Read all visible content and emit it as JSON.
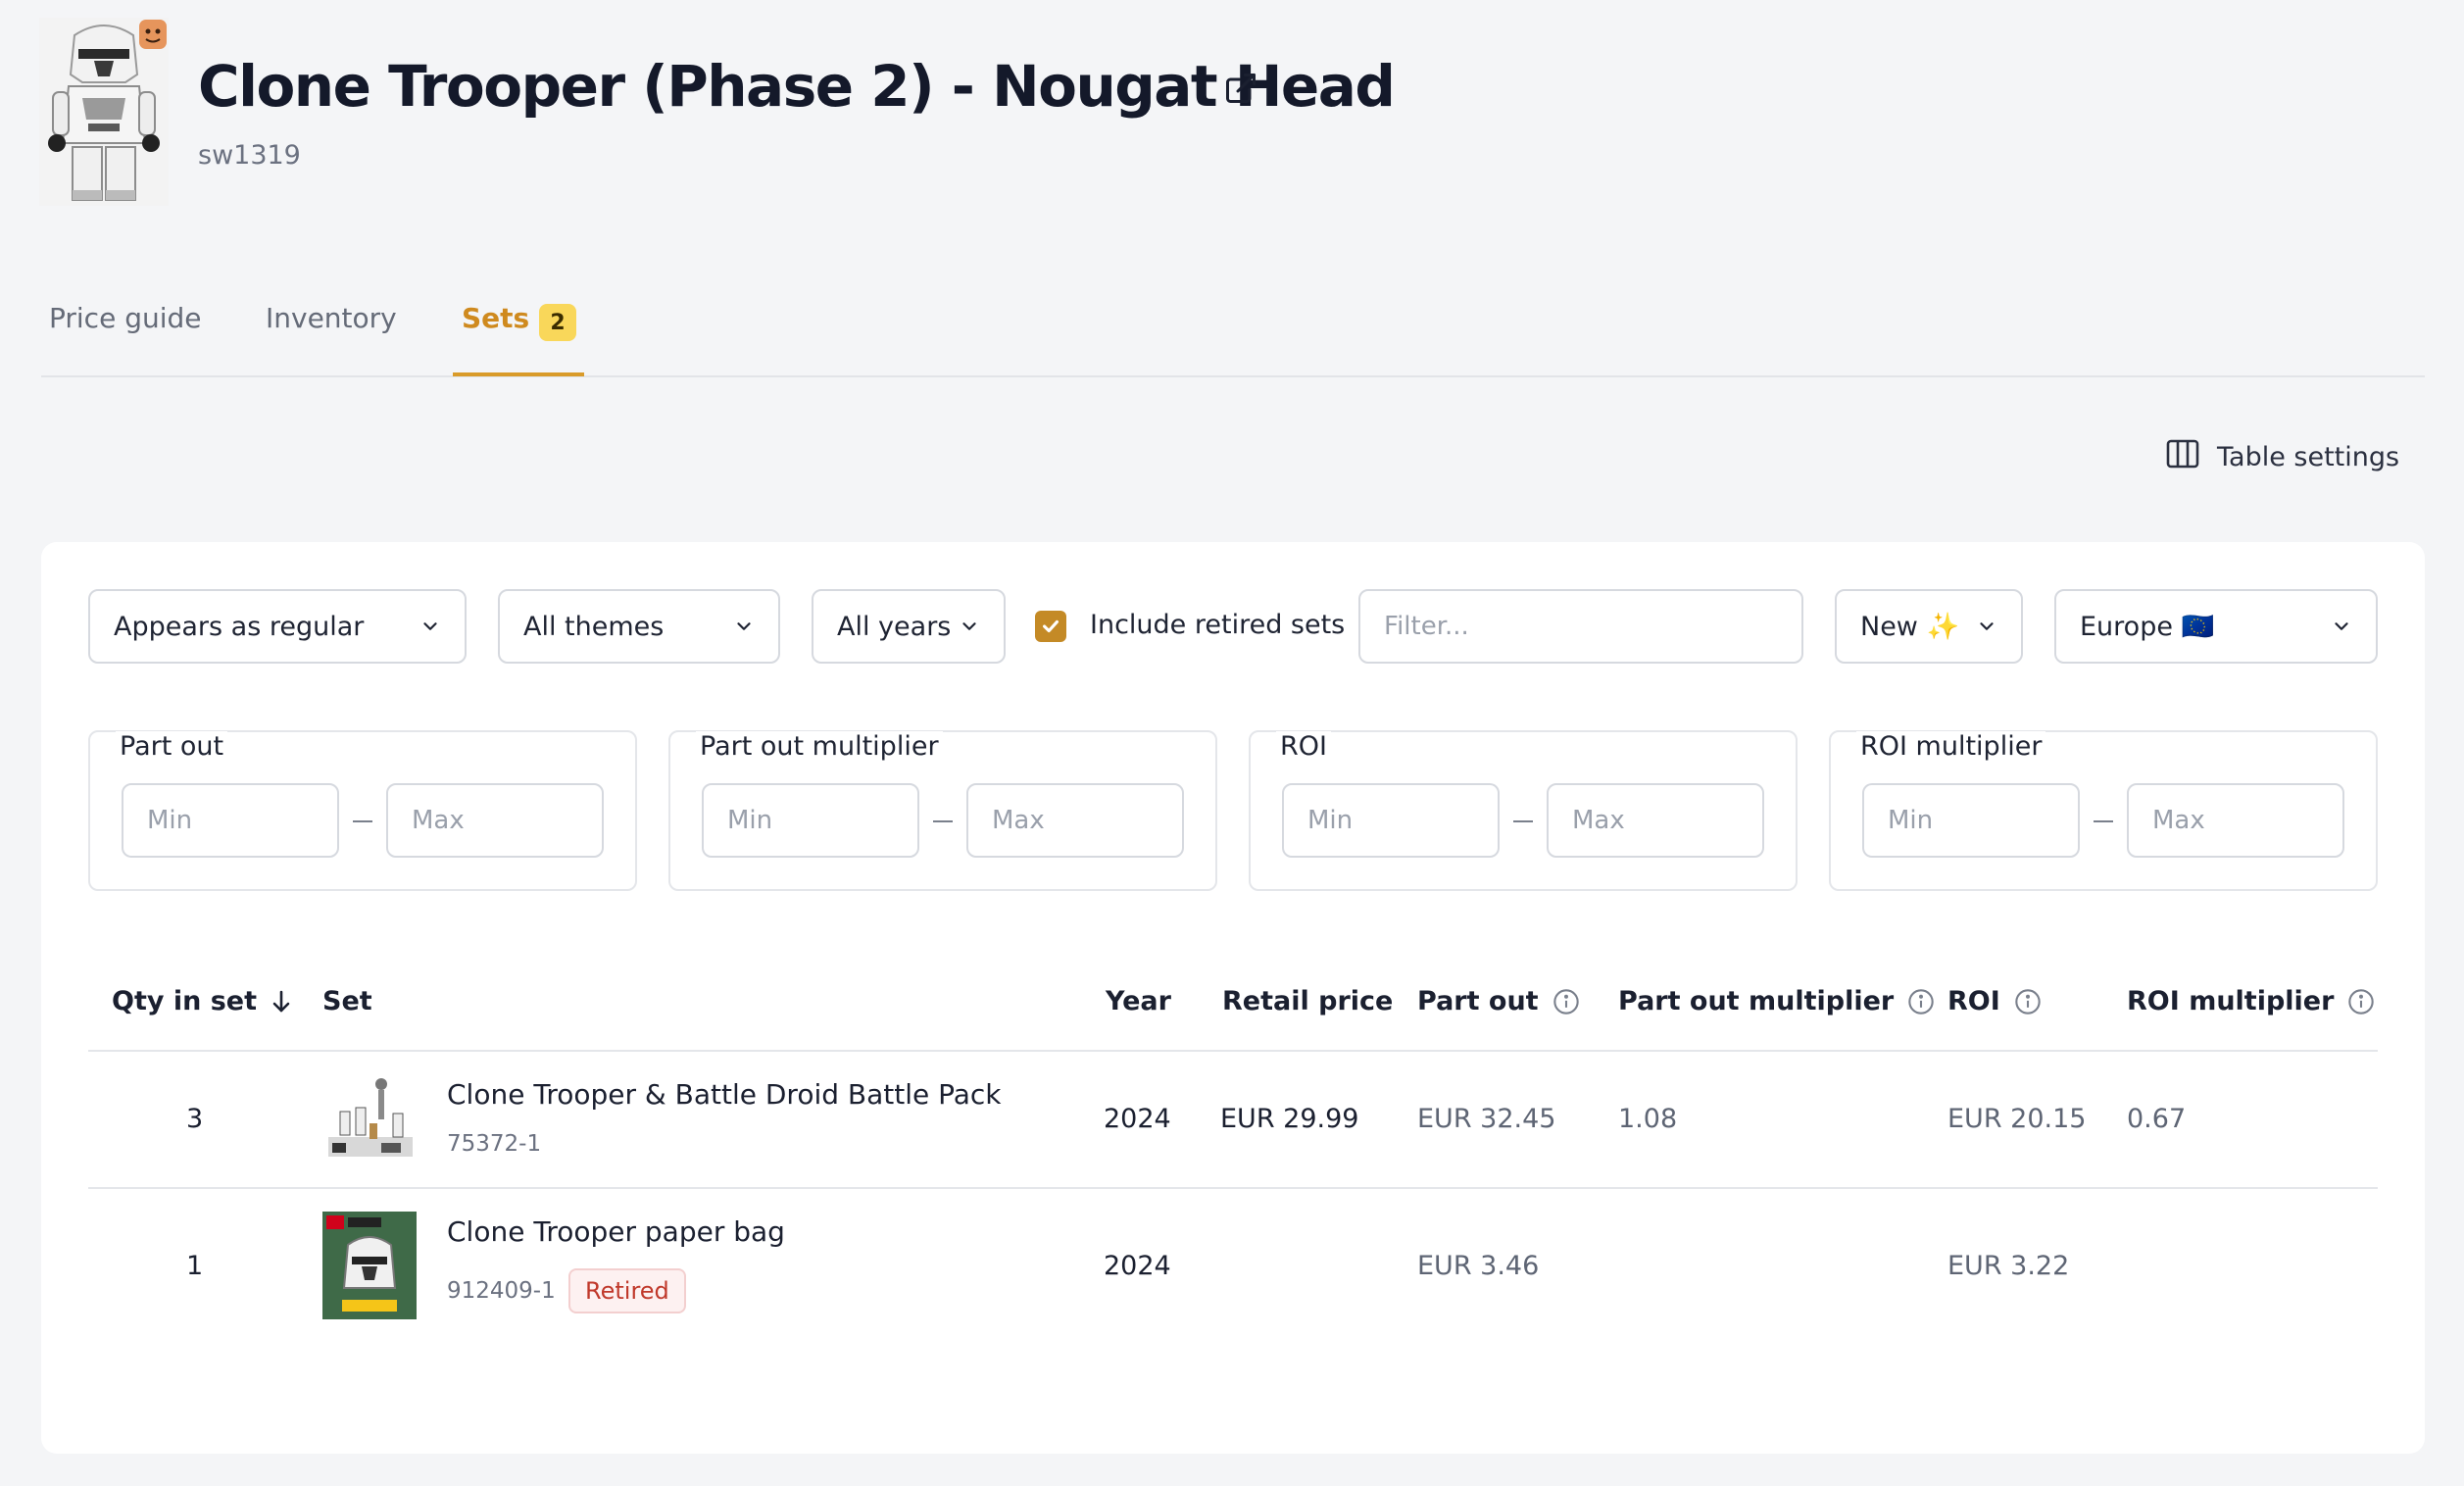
{
  "header": {
    "title": "Clone Trooper (Phase 2) - Nougat Head",
    "item_id": "sw1319"
  },
  "tabs": [
    {
      "label": "Price guide",
      "active": false
    },
    {
      "label": "Inventory",
      "active": false
    },
    {
      "label": "Sets",
      "active": true,
      "badge": "2"
    }
  ],
  "toolbar": {
    "table_settings_label": "Table settings"
  },
  "filters": {
    "appearance": "Appears as regular",
    "theme": "All themes",
    "years": "All years",
    "include_retired_label": "Include retired sets",
    "include_retired_checked": true,
    "filter_placeholder": "Filter...",
    "condition": "New ✨",
    "region": "Europe 🇪🇺"
  },
  "ranges": [
    {
      "label": "Part out",
      "min_placeholder": "Min",
      "max_placeholder": "Max"
    },
    {
      "label": "Part out multiplier",
      "min_placeholder": "Min",
      "max_placeholder": "Max"
    },
    {
      "label": "ROI",
      "min_placeholder": "Min",
      "max_placeholder": "Max"
    },
    {
      "label": "ROI multiplier",
      "min_placeholder": "Min",
      "max_placeholder": "Max"
    }
  ],
  "table": {
    "columns": [
      "Qty in set",
      "Set",
      "Year",
      "Retail price",
      "Part out",
      "Part out multiplier",
      "ROI",
      "ROI multiplier"
    ],
    "sort_column": "Qty in set",
    "sort_direction": "descending",
    "rows": [
      {
        "qty": "3",
        "set_name": "Clone Trooper & Battle Droid Battle Pack",
        "set_number": "75372-1",
        "retired": false,
        "year": "2024",
        "retail_price": "EUR 29.99",
        "part_out": "EUR 32.45",
        "part_out_multiplier": "1.08",
        "roi": "EUR 20.15",
        "roi_multiplier": "0.67"
      },
      {
        "qty": "1",
        "set_name": "Clone Trooper paper bag",
        "set_number": "912409-1",
        "retired": true,
        "retired_label": "Retired",
        "year": "2024",
        "retail_price": "",
        "part_out": "EUR 3.46",
        "part_out_multiplier": "",
        "roi": "EUR 3.22",
        "roi_multiplier": ""
      }
    ]
  },
  "colors": {
    "accent": "#d99b2a",
    "badge": "#f9d75a",
    "checkbox": "#c48a26",
    "retired": "#c0392b",
    "background": "#f4f5f7"
  }
}
